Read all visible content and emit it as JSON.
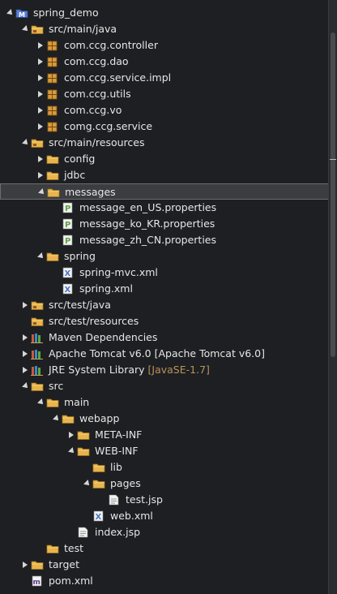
{
  "tree": [
    {
      "label": "spring_demo",
      "icon": "maven-project-icon",
      "expanded": true,
      "depth": 0
    },
    {
      "label": "src/main/java",
      "icon": "source-folder-icon",
      "expanded": true,
      "depth": 1
    },
    {
      "label": "com.ccg.controller",
      "icon": "package-icon",
      "expanded": false,
      "depth": 2
    },
    {
      "label": "com.ccg.dao",
      "icon": "package-icon",
      "expanded": false,
      "depth": 2
    },
    {
      "label": "com.ccg.service.impl",
      "icon": "package-icon",
      "expanded": false,
      "depth": 2
    },
    {
      "label": "com.ccg.utils",
      "icon": "package-icon",
      "expanded": false,
      "depth": 2
    },
    {
      "label": "com.ccg.vo",
      "icon": "package-icon",
      "expanded": false,
      "depth": 2
    },
    {
      "label": "comg.ccg.service",
      "icon": "package-icon",
      "expanded": false,
      "depth": 2
    },
    {
      "label": "src/main/resources",
      "icon": "source-folder-icon",
      "expanded": true,
      "depth": 1
    },
    {
      "label": "config",
      "icon": "folder-icon",
      "expanded": false,
      "depth": 2
    },
    {
      "label": "jdbc",
      "icon": "folder-icon",
      "expanded": false,
      "depth": 2
    },
    {
      "label": "messages",
      "icon": "folder-icon",
      "expanded": true,
      "depth": 2,
      "selected": true
    },
    {
      "label": "message_en_US.properties",
      "icon": "properties-file-icon",
      "depth": 3
    },
    {
      "label": "message_ko_KR.properties",
      "icon": "properties-file-icon",
      "depth": 3
    },
    {
      "label": "message_zh_CN.properties",
      "icon": "properties-file-icon",
      "depth": 3
    },
    {
      "label": "spring",
      "icon": "folder-icon",
      "expanded": true,
      "depth": 2
    },
    {
      "label": "spring-mvc.xml",
      "icon": "xml-file-icon",
      "depth": 3
    },
    {
      "label": "spring.xml",
      "icon": "xml-file-icon",
      "depth": 3
    },
    {
      "label": "src/test/java",
      "icon": "source-folder-icon",
      "expanded": false,
      "depth": 1
    },
    {
      "label": "src/test/resources",
      "icon": "source-folder-icon",
      "depth": 1
    },
    {
      "label": "Maven Dependencies",
      "icon": "library-icon",
      "expanded": false,
      "depth": 1
    },
    {
      "label": "Apache Tomcat v6.0 [Apache Tomcat v6.0]",
      "icon": "library-icon",
      "expanded": false,
      "depth": 1
    },
    {
      "label": "JRE System Library",
      "decoration": "[JavaSE-1.7]",
      "icon": "library-icon",
      "expanded": false,
      "depth": 1
    },
    {
      "label": "src",
      "icon": "folder-icon",
      "expanded": true,
      "depth": 1
    },
    {
      "label": "main",
      "icon": "folder-icon",
      "expanded": true,
      "depth": 2
    },
    {
      "label": "webapp",
      "icon": "folder-icon",
      "expanded": true,
      "depth": 3
    },
    {
      "label": "META-INF",
      "icon": "folder-icon",
      "expanded": false,
      "depth": 4
    },
    {
      "label": "WEB-INF",
      "icon": "folder-icon",
      "expanded": true,
      "depth": 4
    },
    {
      "label": "lib",
      "icon": "folder-icon",
      "depth": 5
    },
    {
      "label": "pages",
      "icon": "folder-icon",
      "expanded": true,
      "depth": 5
    },
    {
      "label": "test.jsp",
      "icon": "jsp-file-icon",
      "depth": 6
    },
    {
      "label": "web.xml",
      "icon": "xml-file-icon",
      "depth": 5
    },
    {
      "label": "index.jsp",
      "icon": "jsp-file-icon",
      "depth": 4
    },
    {
      "label": "test",
      "icon": "folder-icon",
      "depth": 2
    },
    {
      "label": "target",
      "icon": "folder-icon",
      "expanded": false,
      "depth": 1
    },
    {
      "label": "pom.xml",
      "icon": "pom-file-icon",
      "depth": 1
    }
  ],
  "colors": {
    "background": "#1e1f22",
    "text": "#e6e6e6",
    "decoration": "#b8935a",
    "selection": "#3b3d41",
    "folder": "#e8b44d",
    "package": "#d89a3a",
    "properties": "#5aa83c",
    "xml": "#4a78c8"
  }
}
